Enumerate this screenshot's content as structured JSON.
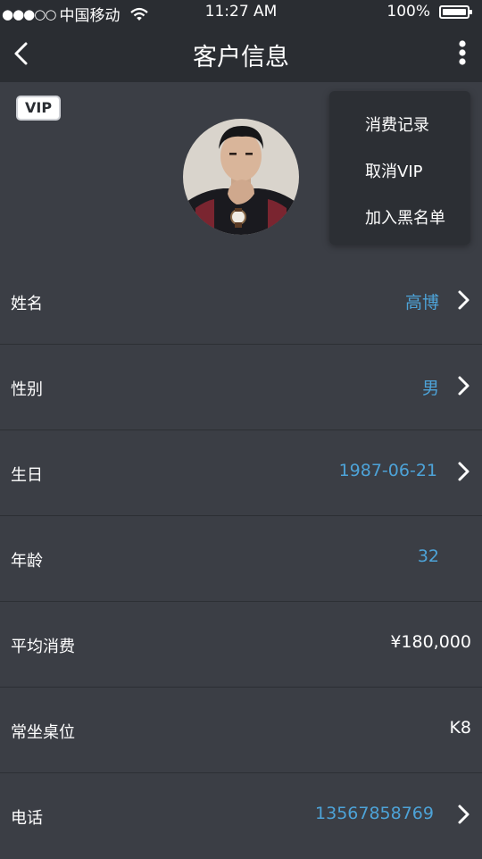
{
  "status_bar": {
    "signal": "●●●○○",
    "carrier": "中国移动",
    "time": "11:27 AM",
    "battery": "100%"
  },
  "nav": {
    "title": "客户信息"
  },
  "badge": {
    "vip": "VIP"
  },
  "menu": {
    "items": [
      "消费记录",
      "取消VIP",
      "加入黑名单"
    ]
  },
  "fields": [
    {
      "label": "姓名",
      "value": "高博"
    },
    {
      "label": "性别",
      "value": "男"
    },
    {
      "label": "生日",
      "value": "1987-06-21"
    },
    {
      "label": "年龄",
      "value": "32"
    },
    {
      "label": "平均消费",
      "value": "¥180,000"
    },
    {
      "label": "常坐桌位",
      "value": "K8"
    },
    {
      "label": "电话",
      "value": "13567858769"
    }
  ],
  "colors": {
    "background": "#3b3e45",
    "bar": "#2a2d32",
    "accent": "#4da3d8"
  }
}
